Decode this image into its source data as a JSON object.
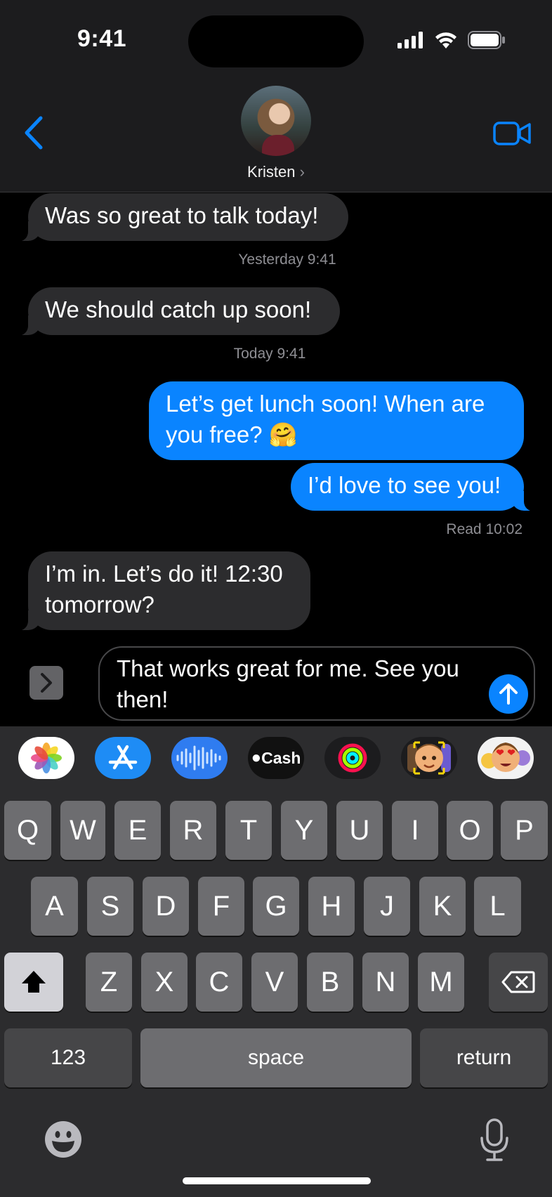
{
  "status_bar": {
    "time": "9:41"
  },
  "header": {
    "contact_name": "Kristen",
    "chevron": "›"
  },
  "messages": [
    {
      "dir": "in",
      "text": "Was so great to talk today!"
    },
    {
      "stamp": "Yesterday 9:41"
    },
    {
      "dir": "in",
      "text": "We should catch up soon!"
    },
    {
      "stamp": "Today 9:41"
    },
    {
      "dir": "out",
      "text": "Let’s get lunch soon! When are you free? 🤗"
    },
    {
      "dir": "out",
      "text": "I’d love to see you!"
    },
    {
      "read": "Read 10:02"
    },
    {
      "dir": "in",
      "text": "I’m in. Let’s do it! 12:30 tomorrow?"
    }
  ],
  "compose": {
    "value": "That works great for me. See you then!"
  },
  "app_drawer": {
    "items": [
      {
        "name": "photos-app",
        "label": ""
      },
      {
        "name": "app-store-app",
        "label": ""
      },
      {
        "name": "audio-message-app",
        "label": ""
      },
      {
        "name": "apple-cash-app",
        "label": "Cash"
      },
      {
        "name": "activity-app",
        "label": ""
      },
      {
        "name": "memoji-app",
        "label": ""
      },
      {
        "name": "animoji-stickers-app",
        "label": ""
      }
    ]
  },
  "keyboard": {
    "row1": [
      "Q",
      "W",
      "E",
      "R",
      "T",
      "Y",
      "U",
      "I",
      "O",
      "P"
    ],
    "row2": [
      "A",
      "S",
      "D",
      "F",
      "G",
      "H",
      "J",
      "K",
      "L"
    ],
    "row3": [
      "Z",
      "X",
      "C",
      "V",
      "B",
      "N",
      "M"
    ],
    "numbers_key": "123",
    "space_key": "space",
    "return_key": "return"
  },
  "colors": {
    "accent": "#0a84ff",
    "incoming_bubble": "#2c2c2e",
    "background": "#000000"
  }
}
